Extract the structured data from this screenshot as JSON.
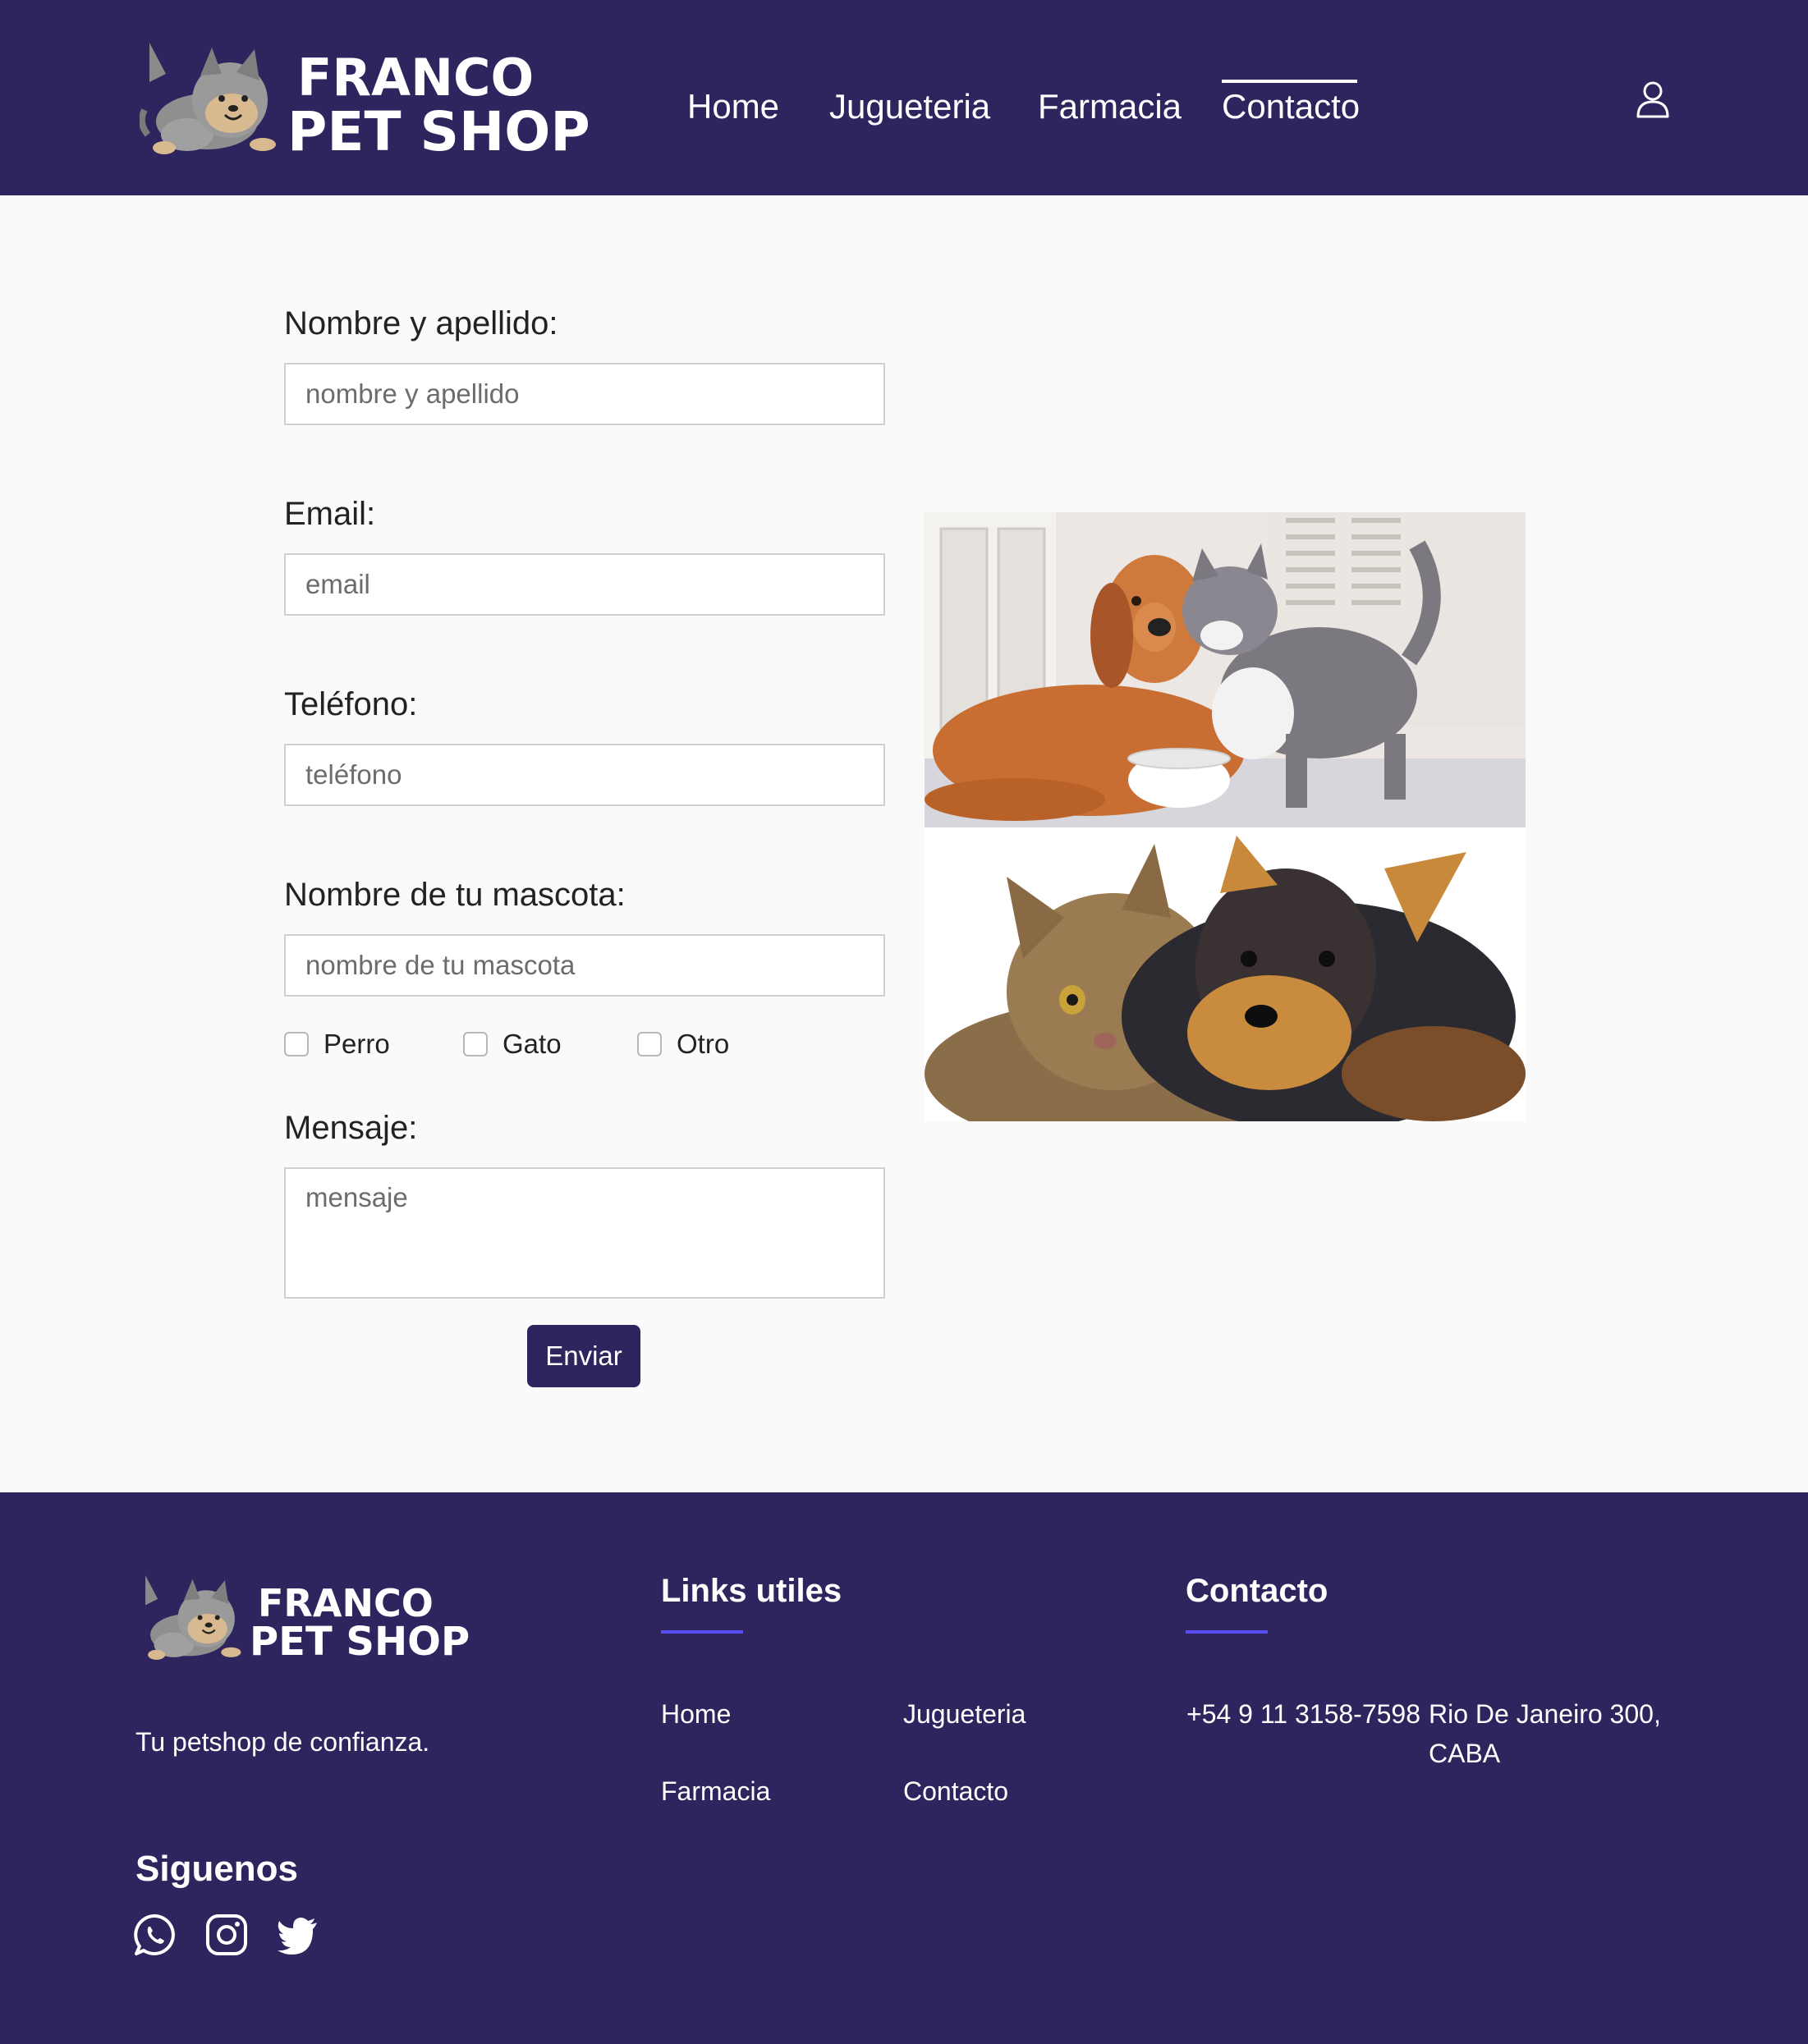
{
  "brand": {
    "line1": "FRANCO",
    "line2": "PET SHOP",
    "primary_color": "#2e245e",
    "accent_color": "#5b4ef0"
  },
  "header": {
    "nav": [
      {
        "label": "Home",
        "active": false
      },
      {
        "label": "Jugueteria",
        "active": false
      },
      {
        "label": "Farmacia",
        "active": false
      },
      {
        "label": "Contacto",
        "active": true
      }
    ],
    "user_icon": "user-icon"
  },
  "form": {
    "name": {
      "label": "Nombre y apellido:",
      "placeholder": "nombre y apellido",
      "value": ""
    },
    "email": {
      "label": "Email:",
      "placeholder": "email",
      "value": ""
    },
    "phone": {
      "label": "Teléfono:",
      "placeholder": "teléfono",
      "value": ""
    },
    "pet": {
      "label": "Nombre de tu mascota:",
      "placeholder": "nombre de tu mascota",
      "value": ""
    },
    "pet_types": [
      {
        "label": "Perro",
        "checked": false
      },
      {
        "label": "Gato",
        "checked": false
      },
      {
        "label": "Otro",
        "checked": false
      }
    ],
    "message": {
      "label": "Mensaje:",
      "placeholder": "mensaje",
      "value": ""
    },
    "submit_label": "Enviar"
  },
  "images": [
    {
      "subject": "golden retriever dog and grey cat with food bowl"
    },
    {
      "subject": "tabby cat and yorkshire terrier puppy"
    }
  ],
  "footer": {
    "tagline": "Tu petshop de confianza.",
    "follow_heading": "Siguenos",
    "social_icons": [
      "whatsapp-icon",
      "instagram-icon",
      "twitter-icon"
    ],
    "links_heading": "Links utiles",
    "links": [
      "Home",
      "Jugueteria",
      "Farmacia",
      "Contacto"
    ],
    "contact_heading": "Contacto",
    "phone": "+54 9 11 3158-7598",
    "address_line1": "Rio De Janeiro 300,",
    "address_line2": "CABA"
  }
}
